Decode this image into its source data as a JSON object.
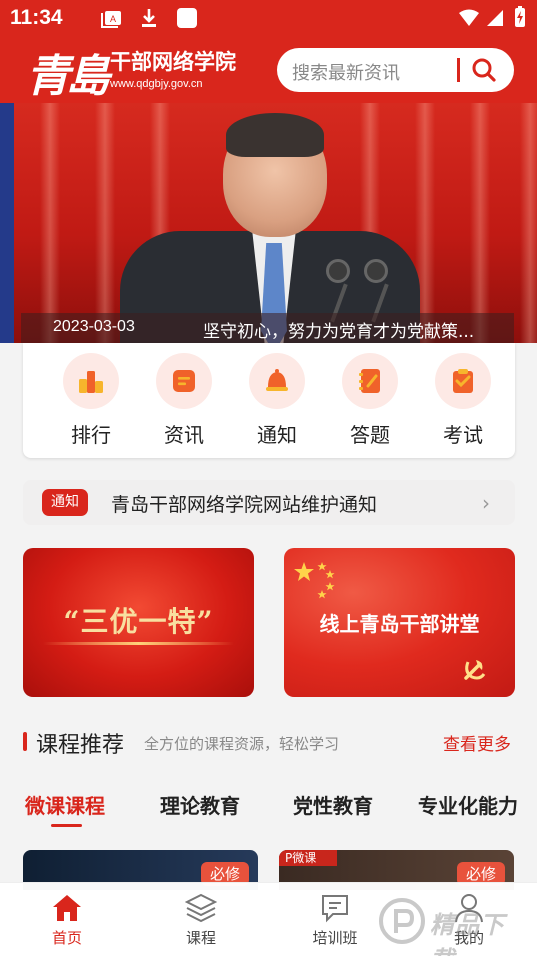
{
  "status_bar": {
    "time": "11:34"
  },
  "header": {
    "logo_calligraphy": "青島",
    "logo_name": "干部网络学院",
    "logo_url": "www.qdgbjy.gov.cn",
    "search_placeholder": "搜索最新资讯"
  },
  "banner": {
    "date": "2023-03-03",
    "title": "坚守初心，努力为党育才为党献策..."
  },
  "quick_menu": [
    {
      "label": "排行",
      "icon": "ranking-icon"
    },
    {
      "label": "资讯",
      "icon": "news-icon"
    },
    {
      "label": "通知",
      "icon": "bell-icon"
    },
    {
      "label": "答题",
      "icon": "quiz-icon"
    },
    {
      "label": "考试",
      "icon": "exam-icon"
    }
  ],
  "notice": {
    "tag": "通知",
    "text": "青岛干部网络学院网站维护通知"
  },
  "promos": {
    "left_text": "“三优一特”",
    "right_text": "线上青岛干部讲堂"
  },
  "course_section": {
    "title": "课程推荐",
    "subtitle": "全方位的课程资源，轻松学习",
    "more": "查看更多",
    "tabs": [
      "微课课程",
      "理论教育",
      "党性教育",
      "专业化能力"
    ],
    "active_tab": 0,
    "cards": [
      {
        "badge": "必修",
        "tag": ""
      },
      {
        "badge": "必修",
        "tag": "P微课"
      }
    ]
  },
  "bottom_nav": [
    {
      "label": "首页",
      "icon": "home-icon",
      "active": true
    },
    {
      "label": "课程",
      "icon": "layers-icon",
      "active": false
    },
    {
      "label": "培训班",
      "icon": "chat-icon",
      "active": false
    },
    {
      "label": "我的",
      "icon": "user-icon",
      "active": false
    }
  ],
  "watermark": "精品下载",
  "colors": {
    "brand_red": "#d9261c",
    "icon_orange": "#f0622a",
    "icon_yellow": "#f7b52c"
  }
}
